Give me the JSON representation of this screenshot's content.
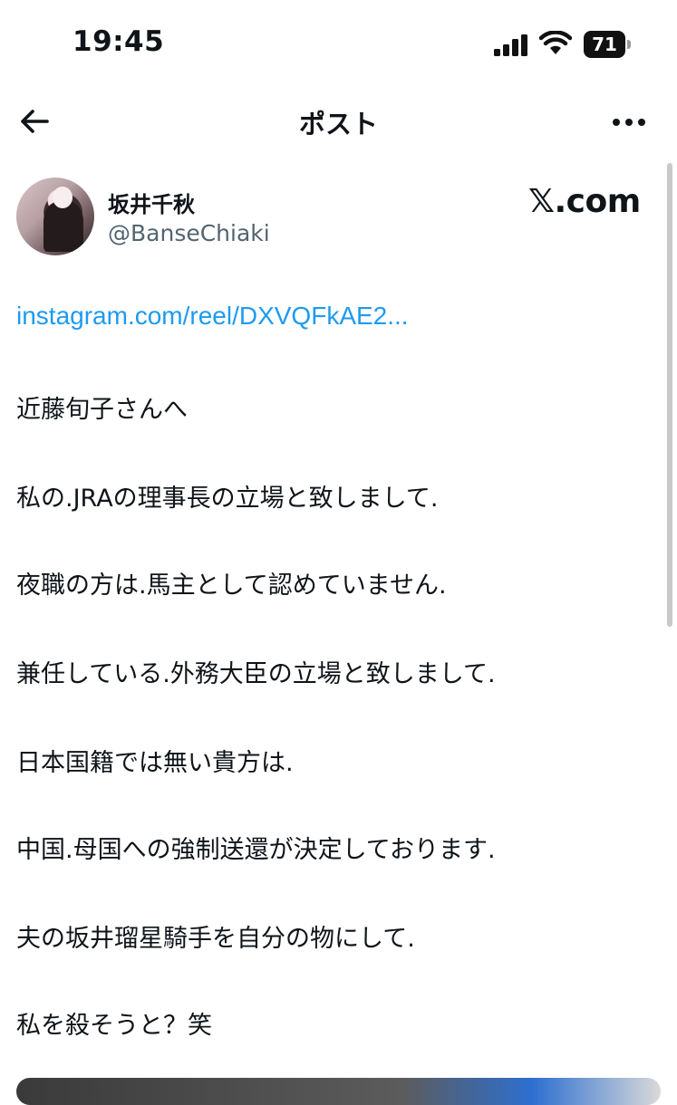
{
  "status_bar": {
    "time": "19:45",
    "battery_level": "71",
    "icons": [
      "signal-icon",
      "wifi-icon",
      "battery-icon"
    ]
  },
  "nav": {
    "title": "ポスト",
    "back_icon": "arrow-left-icon",
    "more_icon": "more-horizontal-icon"
  },
  "author": {
    "display_name": "坂井千秋",
    "handle": "@BanseChiaki",
    "brand": "𝕏.com"
  },
  "post": {
    "link_text": "instagram.com/reel/DXVQFkAE2...",
    "lines": [
      "近藤旬子さんへ",
      "私の.JRAの理事長の立場と致しまして.",
      "夜職の方は.馬主として認めていません.",
      "兼任している.外務大臣の立場と致しまして.",
      "日本国籍では無い貴方は.",
      "中国.母国への強制送還が決定しております.",
      "夫の坂井瑠星騎手を自分の物にして.",
      "私を殺そうと？笑"
    ]
  },
  "colors": {
    "link": "#1d9bf0",
    "text": "#0f1419",
    "secondary": "#536471"
  }
}
